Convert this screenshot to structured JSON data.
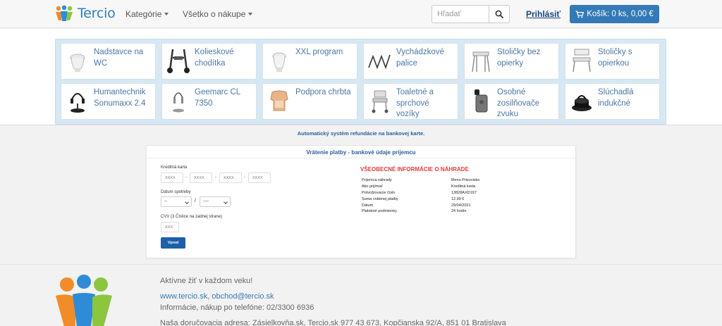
{
  "header": {
    "brand": "Tercio",
    "nav": [
      {
        "label": "Kategórie"
      },
      {
        "label": "Všetko o nákupe"
      }
    ],
    "search_placeholder": "Hľadať",
    "login_label": "Prihlásiť",
    "cart_label": "Košík: 0 ks, 0,00 €"
  },
  "categories": [
    {
      "label": "Nadstavce na WC",
      "icon": "toilet-seat-icon"
    },
    {
      "label": "Kolieskové chodítka",
      "icon": "rollator-icon"
    },
    {
      "label": "XXL program",
      "icon": "toilet-icon"
    },
    {
      "label": "Vychádzkové palice",
      "icon": "walking-stick-icon"
    },
    {
      "label": "Stoličky bez opierky",
      "icon": "stool-icon"
    },
    {
      "label": "Stoličky s opierkou",
      "icon": "chair-icon"
    },
    {
      "label": "Humantechnik Sonumaxx 2.4",
      "icon": "headphones-icon"
    },
    {
      "label": "Geemarc CL 7350",
      "icon": "headset-icon"
    },
    {
      "label": "Podpora chrbta",
      "icon": "back-support-icon"
    },
    {
      "label": "Toaletné a sprchové vozíky",
      "icon": "shower-chair-icon"
    },
    {
      "label": "Osobné zosilňovače zvuku",
      "icon": "amplifier-icon"
    },
    {
      "label": "Slúchadlá indukčné",
      "icon": "induction-loop-icon"
    }
  ],
  "refund_note": "Automatický systém refundácie na bankovej karte.",
  "form": {
    "title": "Vrátenie platby - bankové údaje prijemcu",
    "card_label": "Kreditná karta",
    "card_placeholder": "XXXX",
    "date_label": "Dátum spotreby",
    "month_value": "--",
    "date_separator": "/",
    "year_value": "----",
    "cvv_label": "CVV (3 Číslice na zadnej strane)",
    "cvv_placeholder": "XXX",
    "submit_label": "Vpred"
  },
  "info": {
    "title": "VŠEOBECNÉ INFORMÁCIE O NÁHRADE",
    "rows": [
      {
        "key": "Prijemca náhrady",
        "value": "Meno Priezvisko"
      },
      {
        "key": "Ako prijímať",
        "value": "Kreditná karta"
      },
      {
        "key": "Potvrdzovacie číslo",
        "value": "13828AXD197"
      },
      {
        "key": "Suma vrátenej platby",
        "value": "12,99 €"
      },
      {
        "key": "Dátum",
        "value": "29/04/2021"
      },
      {
        "key": "Platobné podmienky",
        "value": "24 hodín"
      }
    ]
  },
  "footer": {
    "tagline": "Aktívne žiť v každom veku!",
    "links": "www.tercio.sk, obchod@tercio.sk",
    "phone": "Informácie, nákup po telefóne: 02/3300 6936",
    "address": "Naša doručovacia adresa: Zásielkovňa.sk, Tercio.sk 977 43 673, Kopčianska 92/A, 851 01 Bratislava"
  },
  "colors": {
    "primary": "#337ab7",
    "link": "#16457a",
    "alert": "#e23a3a",
    "panel": "#d7e8f3"
  }
}
